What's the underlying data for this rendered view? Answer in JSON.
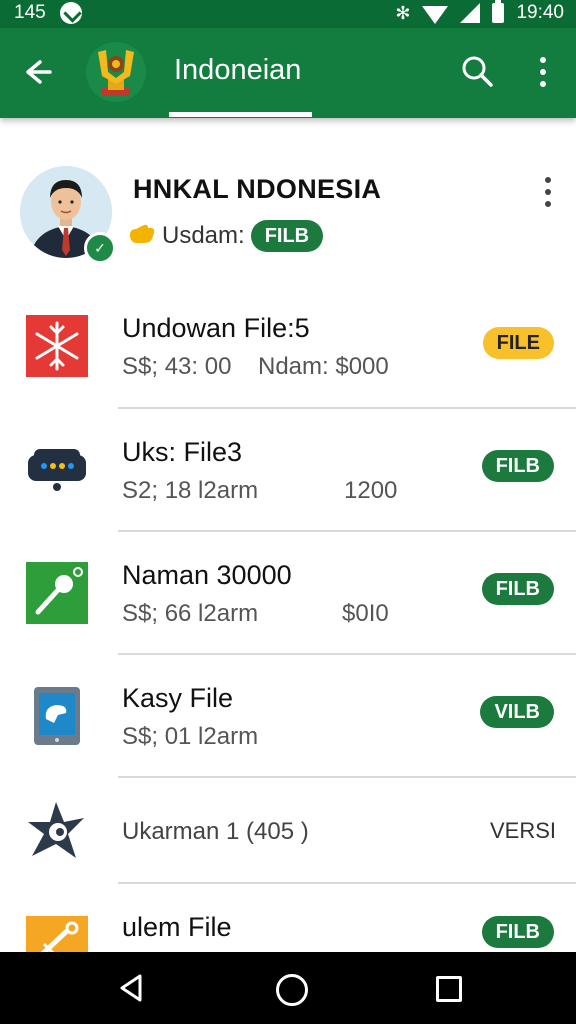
{
  "status_bar": {
    "left_number": "145",
    "time": "19:40",
    "bluetooth_glyph": "✻"
  },
  "app_bar": {
    "title": "Indoneian",
    "icons": [
      "back-arrow-icon",
      "app-logo-icon",
      "search-icon",
      "more-vert-icon"
    ]
  },
  "profile": {
    "name": "HNKAL NDONESIA",
    "status_label": "Usdam:",
    "status_badge": "FILB"
  },
  "list": [
    {
      "icon": "snowflake-icon",
      "title": "Undowan File:5",
      "subtitle": "S$; 43: 00",
      "amount": "Ndam: $000",
      "tag": "FILE",
      "tag_style": "yellow"
    },
    {
      "icon": "vehicle-icon",
      "title": "Uks: File3",
      "subtitle": "S2; 18 l2arm",
      "amount": "1200",
      "tag": "FILB",
      "tag_style": "green"
    },
    {
      "icon": "microphone-icon",
      "title": "Naman 30000",
      "subtitle": "S$; 66 l2arm",
      "amount": "$0I0",
      "tag": "FILB",
      "tag_style": "green"
    },
    {
      "icon": "tablet-icon",
      "title": "Kasy File",
      "subtitle": "S$; 01 l2arm",
      "amount": "",
      "tag": "VILB",
      "tag_style": "green"
    },
    {
      "icon": "ninja-star-icon",
      "title": "",
      "subtitle": "Ukarman 1 (405 )",
      "amount": "",
      "tag": "VERSI",
      "tag_style": "plain"
    },
    {
      "icon": "tools-icon",
      "title": "ulem File",
      "subtitle": "",
      "amount": "",
      "tag": "FILB",
      "tag_style": "green"
    }
  ],
  "colors": {
    "primary": "#137d3f",
    "status_bar": "#0b6b34",
    "badge_green": "#1d7a3f",
    "badge_yellow": "#f8c12c"
  }
}
